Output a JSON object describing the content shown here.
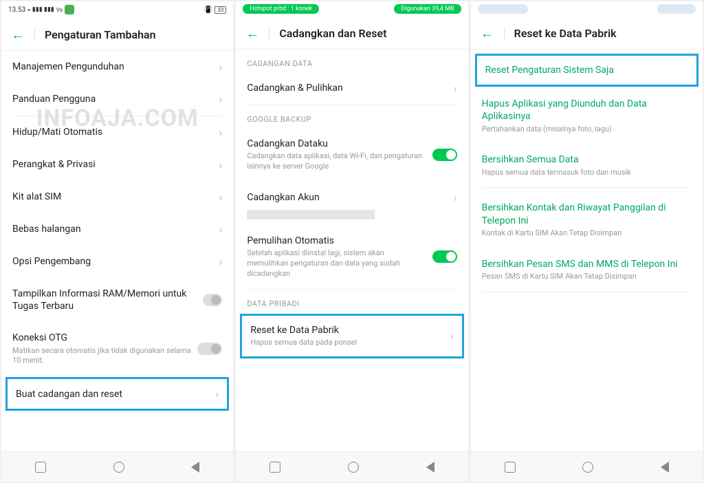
{
  "watermark": "INFOAJA.COM",
  "screen1": {
    "time": "13.53",
    "battery": "33",
    "header": "Pengaturan Tambahan",
    "items": {
      "download": "Manajemen Pengunduhan",
      "guide": "Panduan Pengguna",
      "auto_onoff": "Hidup/Mati Otomatis",
      "device_privacy": "Perangkat & Privasi",
      "sim": "Kit alat SIM",
      "accessibility": "Bebas halangan",
      "developer": "Opsi Pengembang",
      "ram": "Tampilkan Informasi RAM/Memori untuk Tugas Terbaru",
      "otg_title": "Koneksi OTG",
      "otg_sub": "Matikan secara otomatis jika tidak digunakan selama 10 menit.",
      "backup_reset": "Buat cadangan dan reset"
    }
  },
  "screen2": {
    "pill_left": "Hotspot prbd : 1 konek",
    "pill_right": "Digunakan 39,4 MB",
    "header": "Cadangkan dan Reset",
    "sections": {
      "backup_data": "CADANGAN DATA",
      "google_backup": "GOOGLE BACKUP",
      "private_data": "DATA PRIBADI"
    },
    "items": {
      "backup_restore": "Cadangkan & Pulihkan",
      "backup_my_data": "Cadangkan Dataku",
      "backup_my_data_sub": "Cadangkan data aplikasi, data Wi-Fi, dan pengaturan lainnya ke server Google",
      "backup_account": "Cadangkan Akun",
      "auto_restore": "Pemulihan Otomatis",
      "auto_restore_sub": "Setelah aplikasi diinstal lagi, sistem akan memulihkan pengaturan dan data yang sudah dicadangkan",
      "factory_reset": "Reset ke Data Pabrik",
      "factory_reset_sub": "Hapus semua data pada ponsel"
    }
  },
  "screen3": {
    "header": "Reset ke Data Pabrik",
    "items": {
      "reset_system": "Reset Pengaturan Sistem Saja",
      "erase_apps": "Hapus Aplikasi yang Diunduh dan Data Aplikasinya",
      "erase_apps_sub": "Pertahankan data (misalnya foto, lagu)",
      "erase_all": "Bersihkan Semua Data",
      "erase_all_sub": "Hapus semua data termasuk foto dan musik",
      "erase_contacts": "Bersihkan Kontak dan Riwayat Panggilan di Telepon Ini",
      "erase_contacts_sub": "Kontak di Kartu SIM Akan Tetap Disimpan",
      "erase_sms": "Bersihkan Pesan SMS dan MMS di Telepon Ini",
      "erase_sms_sub": "Pesan SMS di Kartu SIM Akan Tetap Disimpan"
    }
  }
}
